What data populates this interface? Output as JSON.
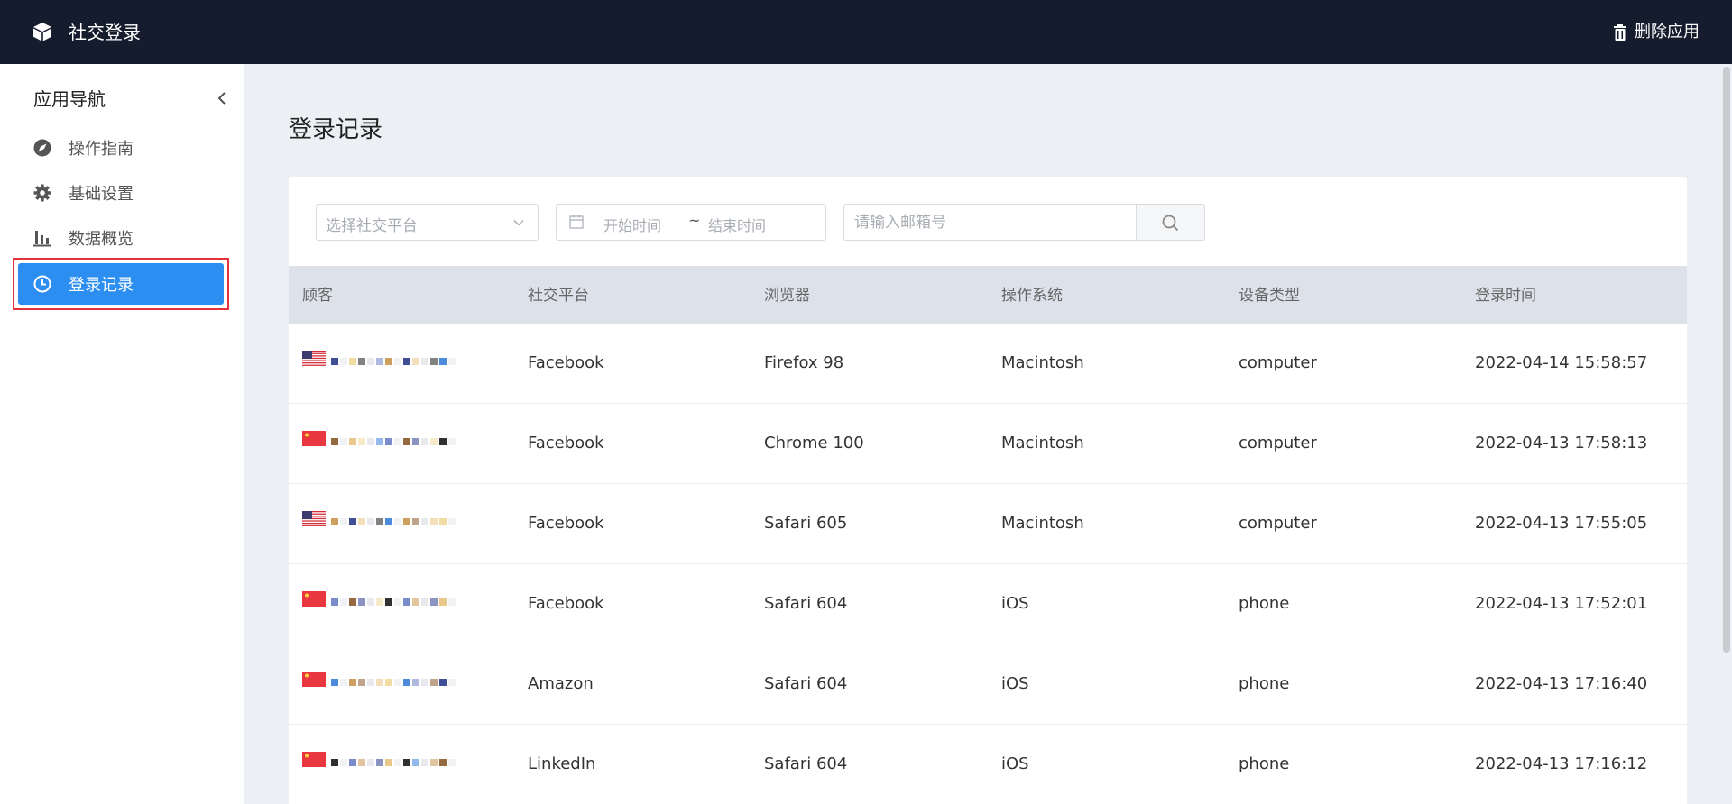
{
  "header": {
    "app_title": "社交登录",
    "delete_label": "删除应用",
    "background_color": "#141c2e"
  },
  "sidebar": {
    "title": "应用导航",
    "items": [
      {
        "label": "操作指南",
        "icon": "compass-icon"
      },
      {
        "label": "基础设置",
        "icon": "gear-icon"
      },
      {
        "label": "数据概览",
        "icon": "bar-chart-icon"
      },
      {
        "label": "登录记录",
        "icon": "clock-icon",
        "active": true
      }
    ],
    "active_color": "#2b8ef0"
  },
  "main": {
    "page_title": "登录记录",
    "filters": {
      "platform_placeholder": "选择社交平台",
      "date_start_placeholder": "开始时间",
      "date_separator": "~",
      "date_end_placeholder": "结束时间",
      "email_placeholder": "请输入邮箱号"
    },
    "table": {
      "columns": [
        "顾客",
        "社交平台",
        "浏览器",
        "操作系统",
        "设备类型",
        "登录时间"
      ],
      "rows": [
        {
          "flag": "us",
          "customer": "",
          "platform": "Facebook",
          "browser": "Firefox 98",
          "os": "Macintosh",
          "device": "computer",
          "time": "2022-04-14 15:58:57"
        },
        {
          "flag": "cn",
          "customer": "",
          "platform": "Facebook",
          "browser": "Chrome 100",
          "os": "Macintosh",
          "device": "computer",
          "time": "2022-04-13 17:58:13"
        },
        {
          "flag": "us",
          "customer": "",
          "platform": "Facebook",
          "browser": "Safari 605",
          "os": "Macintosh",
          "device": "computer",
          "time": "2022-04-13 17:55:05"
        },
        {
          "flag": "cn",
          "customer": "",
          "platform": "Facebook",
          "browser": "Safari 604",
          "os": "iOS",
          "device": "phone",
          "time": "2022-04-13 17:52:01"
        },
        {
          "flag": "cn",
          "customer": "",
          "platform": "Amazon",
          "browser": "Safari 604",
          "os": "iOS",
          "device": "phone",
          "time": "2022-04-13 17:16:40"
        },
        {
          "flag": "cn",
          "customer": "",
          "platform": "LinkedIn",
          "browser": "Safari 604",
          "os": "iOS",
          "device": "phone",
          "time": "2022-04-13 17:16:12"
        }
      ]
    }
  }
}
